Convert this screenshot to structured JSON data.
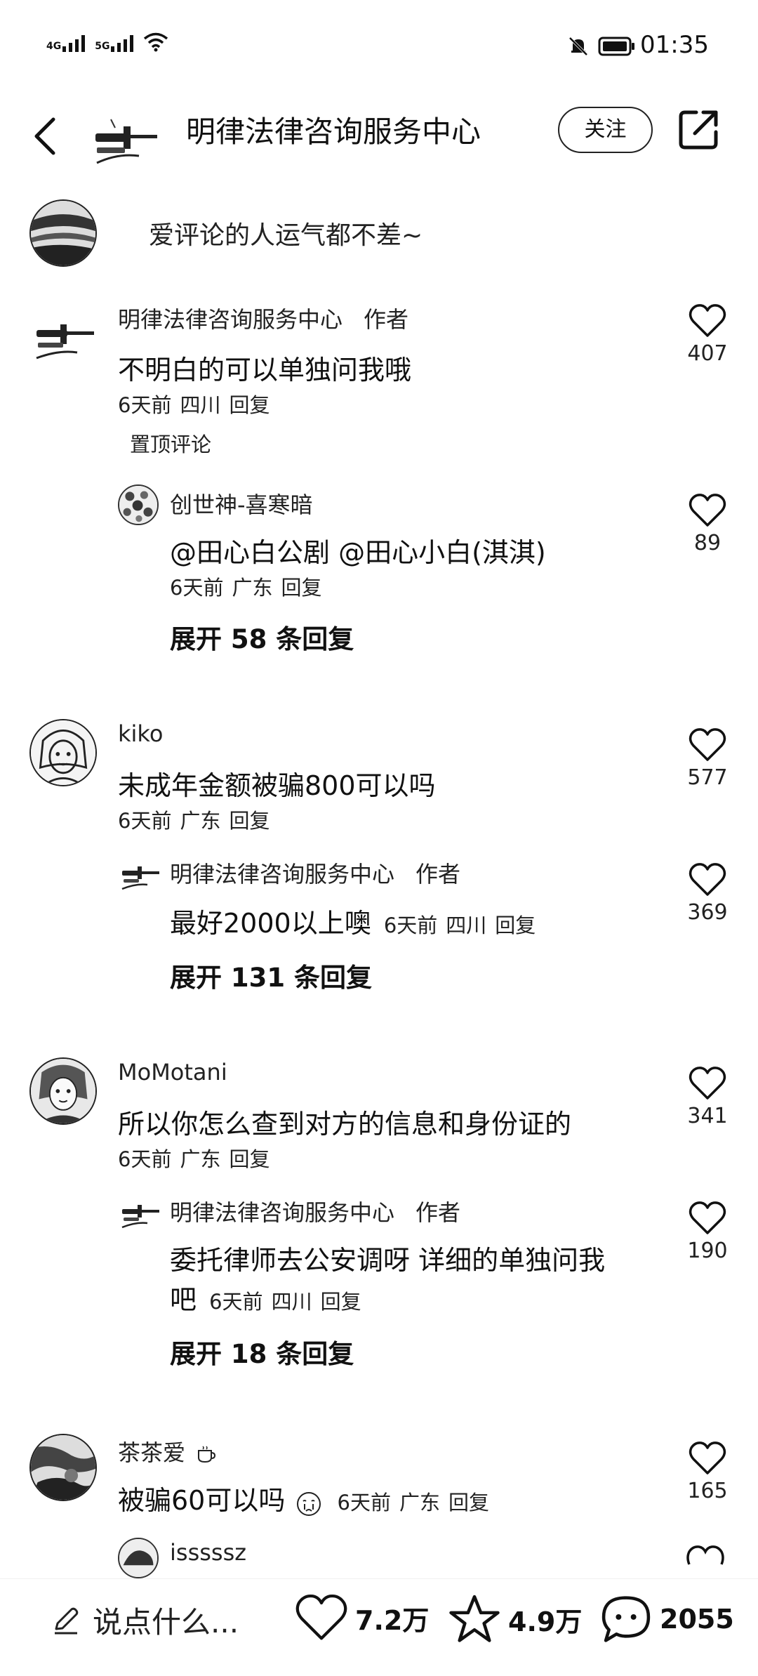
{
  "status_bar": {
    "time": "01:35",
    "network_1": "4G",
    "network_2": "5G"
  },
  "header": {
    "title": "明律法律咨询服务中心",
    "follow_label": "关注"
  },
  "prompt": {
    "text": "爱评论的人运气都不差~"
  },
  "comments": [
    {
      "user": "明律法律咨询服务中心",
      "author_tag": "作者",
      "text": "不明白的可以单独问我哦",
      "time": "6天前",
      "location": "四川",
      "reply": "回复",
      "likes": "407",
      "pinned": "置顶评论",
      "sub": {
        "user": "创世神-喜寒暗",
        "text": "@田心白公剧  @田心小白(淇淇)",
        "time": "6天前",
        "location": "广东",
        "reply": "回复",
        "likes": "89"
      },
      "expand": "展开 58 条回复"
    },
    {
      "user": "kiko",
      "text": "未成年金额被骗800可以吗",
      "time": "6天前",
      "location": "广东",
      "reply": "回复",
      "likes": "577",
      "sub": {
        "user": "明律法律咨询服务中心",
        "author_tag": "作者",
        "text": "最好2000以上噢",
        "time": "6天前",
        "location": "四川",
        "reply": "回复",
        "likes": "369"
      },
      "expand": "展开 131 条回复"
    },
    {
      "user": "MoMotani",
      "text": "所以你怎么查到对方的信息和身份证的",
      "time": "6天前",
      "location": "广东",
      "reply": "回复",
      "likes": "341",
      "sub": {
        "user": "明律法律咨询服务中心",
        "author_tag": "作者",
        "text_line1": "委托律师去公安调呀 详细的单独问我",
        "text_line2": "吧",
        "time": "6天前",
        "location": "四川",
        "reply": "回复",
        "likes": "190"
      },
      "expand": "展开 18 条回复"
    },
    {
      "user": "茶茶爱",
      "text": "被骗60可以吗",
      "time": "6天前",
      "location": "广东",
      "reply": "回复",
      "likes": "165",
      "sub": {
        "user": "isssssz"
      }
    }
  ],
  "bottom_bar": {
    "input_placeholder": "说点什么...",
    "likes": "7.2万",
    "favorites": "4.9万",
    "comments": "2055"
  }
}
